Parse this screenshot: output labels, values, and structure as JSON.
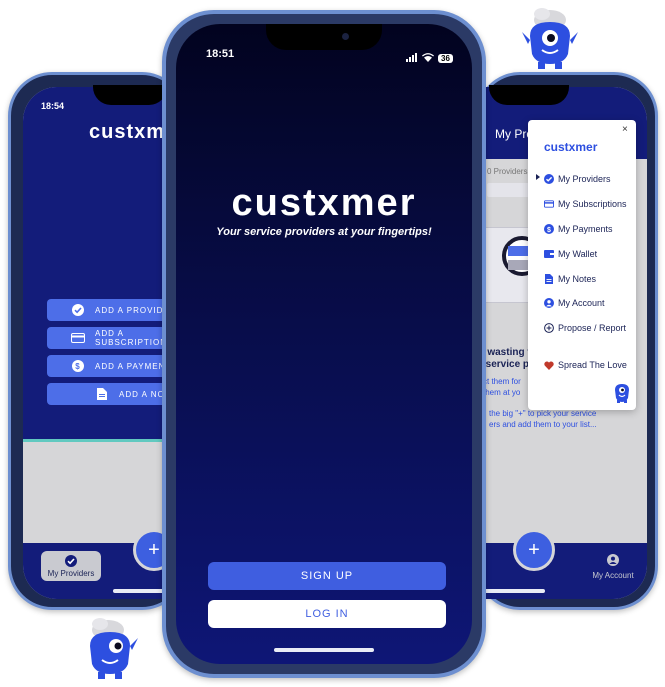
{
  "colors": {
    "navy": "#131c7a",
    "accent_blue": "#4d6ee8",
    "mascot_blue": "#2d4fe0",
    "teal": "#61c9c0"
  },
  "left_phone": {
    "time": "18:54",
    "logo": "custxmer",
    "buttons": [
      {
        "label": "ADD A PROVIDER",
        "icon": "check-circle-icon"
      },
      {
        "label": "ADD A SUBSCRIPTION",
        "icon": "card-icon"
      },
      {
        "label": "ADD A PAYMENT",
        "icon": "dollar-icon"
      },
      {
        "label": "ADD A NOTE",
        "icon": "document-icon"
      }
    ],
    "fab": "+",
    "nav_tab": "My Providers"
  },
  "center_phone": {
    "time": "18:51",
    "battery": "36",
    "logo": "custxmer",
    "tagline": "Your service providers at your fingertips!",
    "sign_up": "SIGN UP",
    "log_in": "LOG IN"
  },
  "right_phone": {
    "header_title": "My Pro",
    "providers_count": "0 Providers",
    "empty_heading_1": "e wasting t",
    "empty_heading_2": "r service p",
    "empty_text_1": "ct them for",
    "empty_text_2": "them at yo",
    "hint_1": "the big \"+\" to pick your service",
    "hint_2": "ers and add them to your list...",
    "fab": "+",
    "nav_account": "My Account"
  },
  "drawer": {
    "close": "×",
    "logo": "custxmer",
    "items": [
      {
        "label": "My Providers",
        "icon": "check-circle-icon"
      },
      {
        "label": "My Subscriptions",
        "icon": "card-icon"
      },
      {
        "label": "My Payments",
        "icon": "dollar-icon"
      },
      {
        "label": "My Wallet",
        "icon": "wallet-icon"
      },
      {
        "label": "My Notes",
        "icon": "document-icon"
      },
      {
        "label": "My Account",
        "icon": "user-icon"
      },
      {
        "label": "Propose / Report",
        "icon": "plus-circle-icon"
      }
    ],
    "spread_love": "Spread The Love"
  }
}
